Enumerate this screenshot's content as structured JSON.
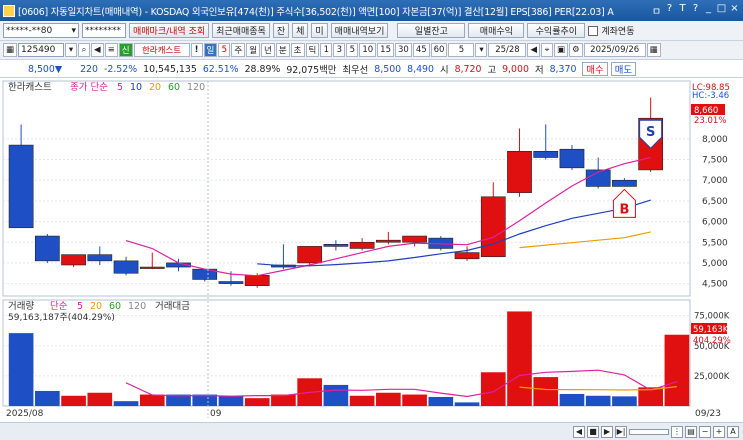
{
  "window": {
    "title": "[0606] 자동일지차트(매매내역) - KOSDAQ 외국인보유[474(천)] 주식수[36,502(천)] 액면[100] 자본금[37(억)] 결산[12월] EPS[386] PER[22.03] A",
    "buttons": [
      "ㅁ",
      "?",
      "T",
      "?",
      "_",
      "□",
      "×"
    ]
  },
  "toolbar1": {
    "account": "*****-**80",
    "password": "********",
    "buttons": [
      "매매마크/내역 조회",
      "최근매매종목",
      "잔",
      "체",
      "미",
      "매매내역보기"
    ],
    "right_buttons": [
      "일별잔고",
      "매매수익",
      "수익률추이"
    ],
    "checkbox_label": "계좌연동"
  },
  "toolbar2": {
    "code": "125490",
    "name": "한라캐스트",
    "period_selected": "일",
    "period_num": "5",
    "period_tabs": [
      "주",
      "월",
      "년",
      "분",
      "초",
      "틱"
    ],
    "minute_tabs": [
      "1",
      "3",
      "5",
      "10",
      "15",
      "30",
      "45",
      "60"
    ],
    "count": "5",
    "page": "25/28",
    "date": "2025/09/26"
  },
  "quote": {
    "price": "8,500",
    "change": "220",
    "change_pct": "-2.52%",
    "volume": "10,545,135",
    "vol_ratio": "62.51%",
    "turnover": "28.89%",
    "amount": "92,075백만",
    "best_ask_label": "최우선",
    "best_ask": "8,500",
    "best_bid": "8,490",
    "open_label": "시",
    "open": "8,720",
    "high_label": "고",
    "high": "9,000",
    "low_label": "저",
    "low": "8,370",
    "buy_label": "매수",
    "sell_label": "매도"
  },
  "price_panel": {
    "stock_name": "한라캐스트",
    "ma_label": "종가 단순",
    "ma_periods": [
      "5",
      "10",
      "20",
      "60",
      "120"
    ],
    "ma_colors": [
      "#e020a0",
      "#1f3fbf",
      "#e8a000",
      "#2a9d2a",
      "#8a8a8a"
    ],
    "lc": "LC:98.85",
    "hc": "HC:-3.46",
    "last_price_tag": "8,660",
    "last_pct_tag": "23.01%",
    "y_ticks": [
      "8,000",
      "7,500",
      "7,000",
      "6,500",
      "6,000",
      "5,500",
      "5,000",
      "4,500"
    ],
    "buy_marker": "B",
    "sell_marker": "S"
  },
  "volume_panel": {
    "label": "거래량",
    "ma_label": "단순",
    "ma_periods": [
      "5",
      "20",
      "60",
      "120"
    ],
    "amount_label": "거래대금",
    "value_text": "59,163,187주(404.29%)",
    "y_ticks": [
      "75,000K",
      "50,000K",
      "25,000K"
    ],
    "last_tag": "59,163K",
    "last_pct_tag": "404.29%"
  },
  "x_axis": {
    "labels": [
      "2025/08",
      "09"
    ],
    "right_label": "09/23"
  },
  "colors": {
    "up": "#e01010",
    "down": "#1f4fc4",
    "ma5": "#e020a0",
    "ma10": "#1f3fbf",
    "ma20": "#e8a000"
  },
  "chart_data": {
    "type": "candlestick",
    "candles": [
      {
        "o": 7850,
        "h": 8350,
        "l": 5850,
        "c": 5850
      },
      {
        "o": 5650,
        "h": 5700,
        "l": 5000,
        "c": 5050
      },
      {
        "o": 4950,
        "h": 5200,
        "l": 4900,
        "c": 5200
      },
      {
        "o": 5200,
        "h": 5400,
        "l": 4950,
        "c": 5050
      },
      {
        "o": 5050,
        "h": 5150,
        "l": 4700,
        "c": 4750
      },
      {
        "o": 4900,
        "h": 5250,
        "l": 4850,
        "c": 4900
      },
      {
        "o": 5000,
        "h": 5100,
        "l": 4800,
        "c": 4900
      },
      {
        "o": 4850,
        "h": 4850,
        "l": 4550,
        "c": 4600
      },
      {
        "o": 4550,
        "h": 4800,
        "l": 4450,
        "c": 4500
      },
      {
        "o": 4450,
        "h": 4750,
        "l": 4400,
        "c": 4700
      },
      {
        "o": 4950,
        "h": 5450,
        "l": 4850,
        "c": 4900
      },
      {
        "o": 5000,
        "h": 5400,
        "l": 4950,
        "c": 5400
      },
      {
        "o": 5450,
        "h": 5550,
        "l": 5300,
        "c": 5400
      },
      {
        "o": 5350,
        "h": 5600,
        "l": 5300,
        "c": 5500
      },
      {
        "o": 5500,
        "h": 5750,
        "l": 5450,
        "c": 5550
      },
      {
        "o": 5500,
        "h": 5650,
        "l": 5400,
        "c": 5650
      },
      {
        "o": 5600,
        "h": 5650,
        "l": 5300,
        "c": 5350
      },
      {
        "o": 5100,
        "h": 5400,
        "l": 5050,
        "c": 5250
      },
      {
        "o": 5150,
        "h": 6950,
        "l": 5150,
        "c": 6600
      },
      {
        "o": 6700,
        "h": 8250,
        "l": 6600,
        "c": 7700
      },
      {
        "o": 7700,
        "h": 8350,
        "l": 7500,
        "c": 7550
      },
      {
        "o": 7750,
        "h": 7850,
        "l": 7250,
        "c": 7300
      },
      {
        "o": 7250,
        "h": 7550,
        "l": 6800,
        "c": 6850
      },
      {
        "o": 7000,
        "h": 7050,
        "l": 6850,
        "c": 6850
      },
      {
        "o": 7250,
        "h": 9000,
        "l": 7200,
        "c": 8500
      }
    ],
    "volume_k": [
      60500,
      12500,
      8500,
      11000,
      4000,
      9500,
      9500,
      9500,
      8000,
      6500,
      9500,
      23000,
      17500,
      8500,
      11000,
      9500,
      7500,
      3000,
      28000,
      78500,
      24000,
      10000,
      8500,
      8000,
      15500,
      59163
    ],
    "ma5": [
      null,
      null,
      null,
      null,
      5540,
      5350,
      5000,
      4850,
      4730,
      4690,
      4820,
      4950,
      5100,
      5250,
      5400,
      5480,
      5460,
      5440,
      5620,
      6020,
      6450,
      6860,
      7200,
      7400,
      7550
    ],
    "ma10": [
      null,
      null,
      null,
      null,
      null,
      null,
      null,
      null,
      null,
      4980,
      4930,
      4930,
      4960,
      5000,
      5050,
      5130,
      5220,
      5300,
      5460,
      5700,
      5900,
      6080,
      6200,
      6320,
      6520
    ],
    "ma20": [
      null,
      null,
      null,
      null,
      null,
      null,
      null,
      null,
      null,
      null,
      null,
      null,
      null,
      null,
      null,
      null,
      null,
      null,
      null,
      5370,
      5430,
      5490,
      5550,
      5610,
      5750
    ],
    "vol_ma5": [
      null,
      null,
      null,
      null,
      19300,
      9100,
      8500,
      8700,
      8100,
      8600,
      8600,
      11300,
      13300,
      13000,
      13900,
      13900,
      10700,
      7900,
      11800,
      25300,
      28000,
      28700,
      29700,
      25800,
      13200,
      20200
    ],
    "vol_ma20": [
      null,
      null,
      null,
      null,
      null,
      null,
      null,
      null,
      null,
      null,
      null,
      null,
      null,
      null,
      null,
      null,
      null,
      null,
      null,
      15700,
      13700,
      13600,
      13500,
      13300,
      13600,
      16100
    ],
    "buy_index": 23,
    "sell_index": 24
  }
}
